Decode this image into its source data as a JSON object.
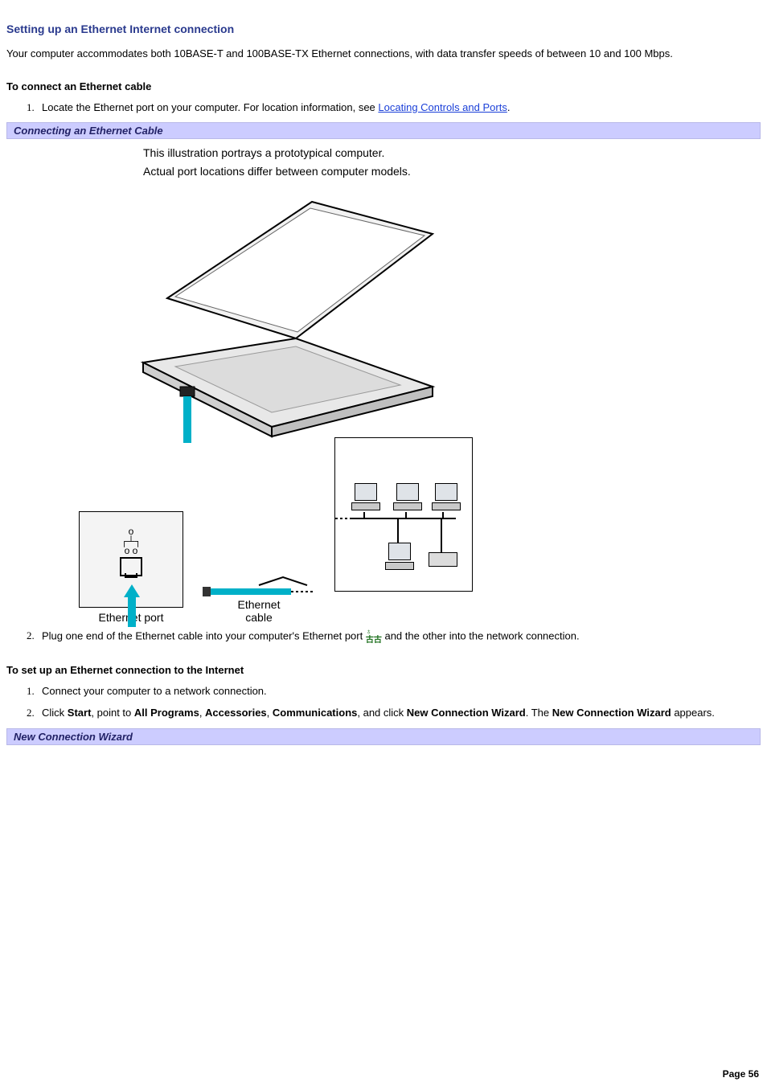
{
  "title": "Setting up an Ethernet Internet connection",
  "intro": "Your computer accommodates both 10BASE-T and 100BASE-TX Ethernet connections, with data transfer speeds of between 10 and 100 Mbps.",
  "section1": {
    "heading": "To connect an Ethernet cable",
    "step1_pre": "Locate the Ethernet port on your computer. For location information, see ",
    "step1_link": "Locating Controls and Ports",
    "step1_post": ".",
    "caption": "Connecting an Ethernet Cable",
    "illnote1": "This illustration portrays a prototypical computer.",
    "illnote2": "Actual port locations differ between computer models.",
    "port_label": "Ethernet port",
    "cable_label1": "Ethernet",
    "cable_label2": "cable",
    "step2_pre": "Plug one end of the Ethernet cable into your computer's Ethernet port ",
    "step2_post": "and the other into the network connection."
  },
  "section2": {
    "heading": "To set up an Ethernet connection to the Internet",
    "step1": "Connect your computer to a network connection.",
    "step2_parts": {
      "p1": "Click ",
      "b1": "Start",
      "p2": ", point to ",
      "b2": "All Programs",
      "p3": ", ",
      "b3": "Accessories",
      "p4": ", ",
      "b4": "Communications",
      "p5": ", and click ",
      "b5": "New Connection Wizard",
      "p6": ". The ",
      "b6": "New Connection Wizard",
      "p7": " appears."
    },
    "caption": "New Connection Wizard"
  },
  "footer": "Page 56"
}
